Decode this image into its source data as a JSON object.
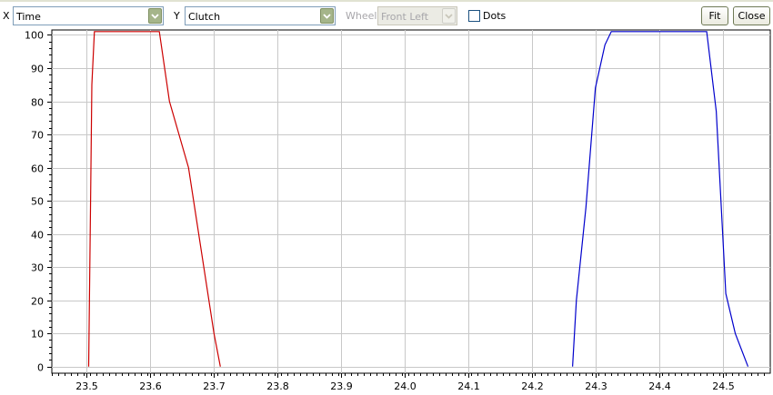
{
  "toolbar": {
    "x_label": "X",
    "x_value": "Time",
    "y_label": "Y",
    "y_value": "Clutch",
    "wheel_label": "Wheel",
    "wheel_value": "Front Left",
    "dots_label": "Dots",
    "dots_checked": false,
    "fit_label": "Fit",
    "close_label": "Close"
  },
  "icons": {
    "dropdown": "chevron-down-icon"
  },
  "chart_data": {
    "type": "line",
    "title": "",
    "xlabel": "",
    "ylabel": "",
    "xlim": [
      23.445,
      24.575
    ],
    "ylim": [
      -2,
      101.5
    ],
    "x_ticks": [
      23.5,
      23.6,
      23.7,
      23.8,
      23.9,
      24.0,
      24.1,
      24.2,
      24.3,
      24.4,
      24.5
    ],
    "x_tick_labels": [
      "23.5",
      "23.6",
      "23.7",
      "23.8",
      "23.9",
      "24.0",
      "24.1",
      "24.2",
      "24.3",
      "24.4",
      "24.5"
    ],
    "y_ticks": [
      0,
      10,
      20,
      30,
      40,
      50,
      60,
      70,
      80,
      90,
      100
    ],
    "y_tick_labels": [
      "0",
      "10",
      "20",
      "30",
      "40",
      "50",
      "60",
      "70",
      "80",
      "90",
      "100"
    ],
    "grid": true,
    "series": [
      {
        "color": "#cc0000",
        "x": [
          23.503,
          23.506,
          23.508,
          23.512,
          23.614,
          23.63,
          23.66,
          23.7,
          23.71
        ],
        "y": [
          0,
          50,
          85,
          101,
          101,
          80,
          60,
          10,
          0
        ]
      },
      {
        "color": "#0000cc",
        "x": [
          24.264,
          24.27,
          24.285,
          24.3,
          24.315,
          24.325,
          24.475,
          24.49,
          24.505,
          24.52,
          24.54
        ],
        "y": [
          0,
          20,
          48,
          84,
          97,
          101,
          101,
          77,
          22,
          10,
          0
        ]
      }
    ]
  }
}
